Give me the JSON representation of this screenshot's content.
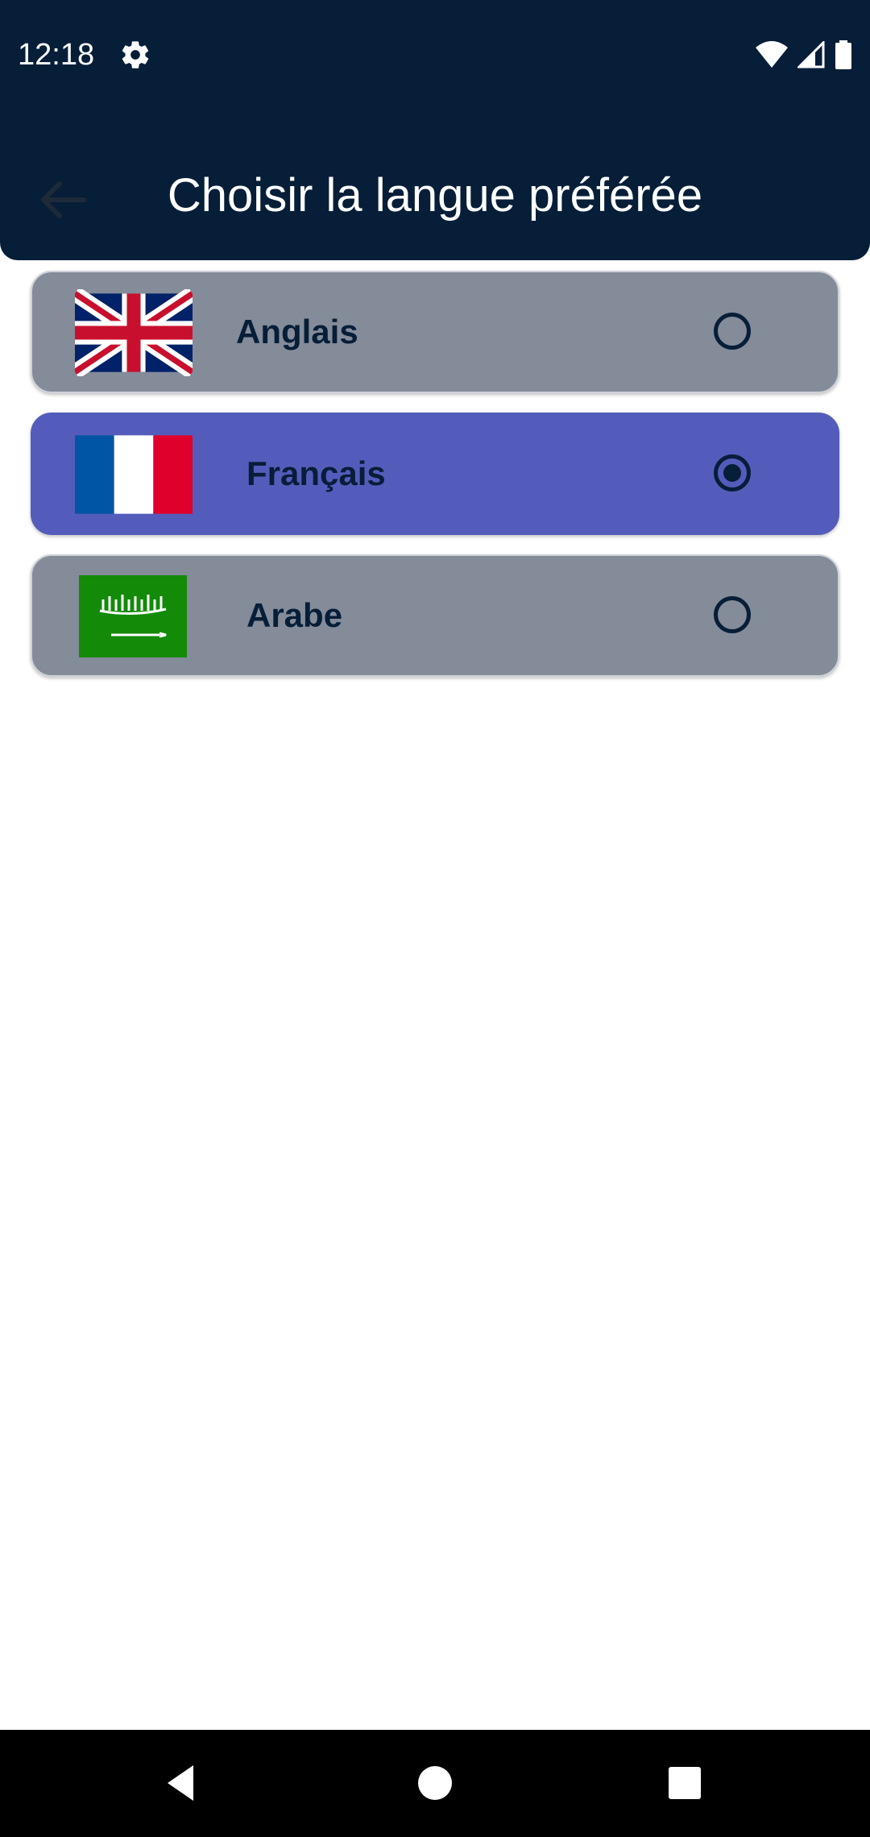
{
  "status_bar": {
    "time": "12:18",
    "icons": [
      "gear-icon",
      "wifi-icon",
      "signal-icon",
      "battery-icon"
    ]
  },
  "header": {
    "title": "Choisir la langue préférée",
    "back_icon": "arrow-left-icon"
  },
  "languages": [
    {
      "label": "Anglais",
      "flag": "uk-flag-icon",
      "selected": false
    },
    {
      "label": "Français",
      "flag": "france-flag-icon",
      "selected": true
    },
    {
      "label": "Arabe",
      "flag": "saudi-flag-icon",
      "selected": false
    }
  ],
  "navigation_bar": {
    "buttons": [
      "back-triangle-icon",
      "home-circle-icon",
      "recents-square-icon"
    ]
  },
  "colors": {
    "header_bg": "#061e38",
    "item_bg": "#848b99",
    "selected_bg": "#545cbb",
    "text": "#061e38"
  }
}
